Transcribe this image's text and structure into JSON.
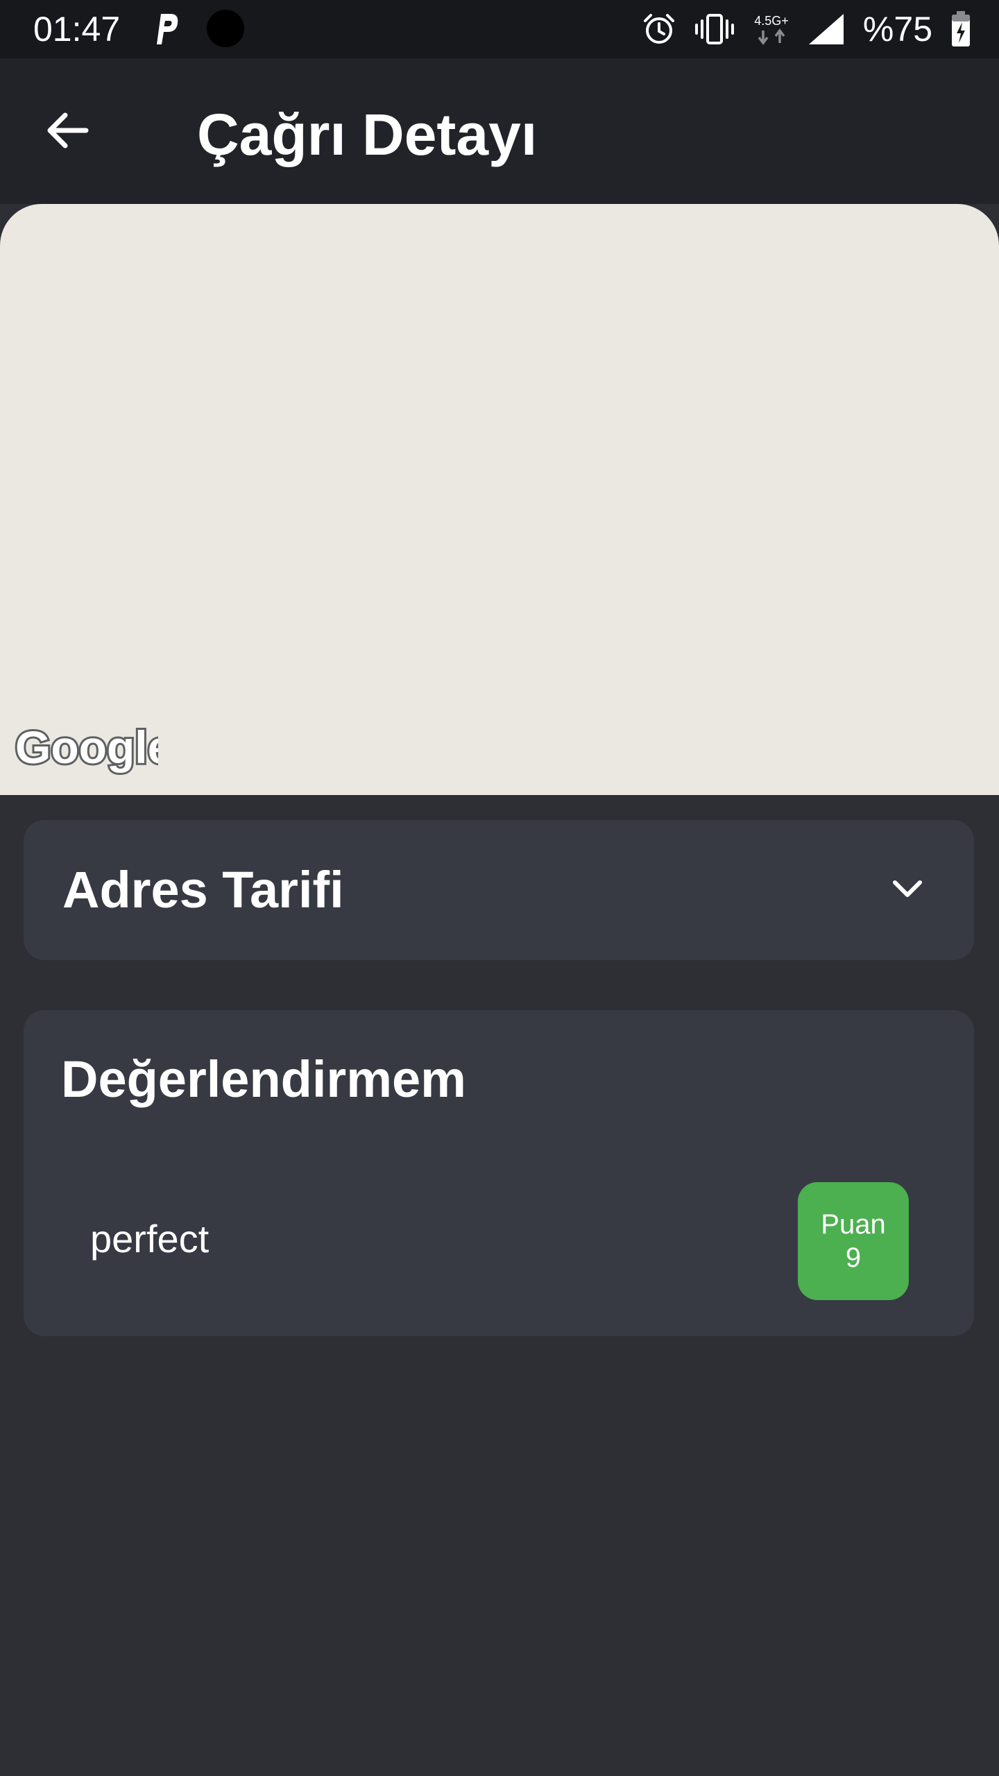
{
  "status_bar": {
    "time": "01:47",
    "network": "4.5G+",
    "battery": "%75",
    "icons": [
      "parking-icon",
      "camera-dot-icon",
      "alarm-icon",
      "vibrate-icon",
      "network-type-icon",
      "signal-icon",
      "battery-charging-icon"
    ]
  },
  "app_bar": {
    "title": "Çağrı Detayı",
    "back_icon": "arrow-left-icon"
  },
  "map": {
    "logo_text": "Google",
    "background": "#ebe8e1"
  },
  "address_card": {
    "title": "Adres Tarifi",
    "expand_icon": "chevron-down-icon"
  },
  "rating_card": {
    "title": "Değerlendirmem",
    "comment": "perfect",
    "score_label": "Puan",
    "score_value": "9",
    "badge_color": "#4caf50"
  }
}
